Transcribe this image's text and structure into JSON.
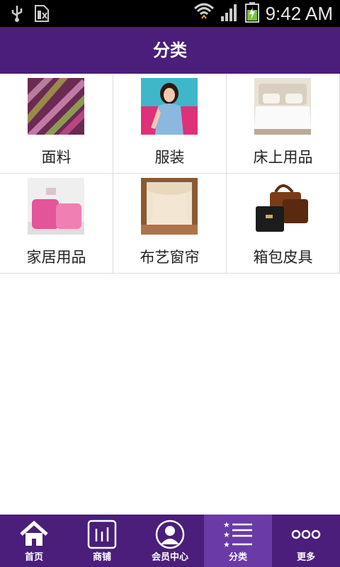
{
  "status_bar": {
    "time": "9:42 AM",
    "icons": [
      "usb-icon",
      "sd-card-icon",
      "wifi-icon",
      "signal-icon",
      "battery-charging-icon"
    ]
  },
  "header": {
    "title": "分类"
  },
  "categories": [
    {
      "label": "面料",
      "icon": "fabric-thumbnail"
    },
    {
      "label": "服装",
      "icon": "clothing-thumbnail"
    },
    {
      "label": "床上用品",
      "icon": "bedding-thumbnail"
    },
    {
      "label": "家居用品",
      "icon": "home-goods-thumbnail"
    },
    {
      "label": "布艺窗帘",
      "icon": "curtain-thumbnail"
    },
    {
      "label": "箱包皮具",
      "icon": "luggage-thumbnail"
    }
  ],
  "tabbar": {
    "active": "分类",
    "tabs": [
      {
        "label": "首页",
        "icon": "home-icon"
      },
      {
        "label": "商铺",
        "icon": "store-icon"
      },
      {
        "label": "会员中心",
        "icon": "member-icon"
      },
      {
        "label": "分类",
        "icon": "category-list-icon"
      },
      {
        "label": "更多",
        "icon": "more-icon"
      }
    ]
  },
  "colors": {
    "primary": "#4a1e7a",
    "active_tab": "#6a3aa6"
  }
}
